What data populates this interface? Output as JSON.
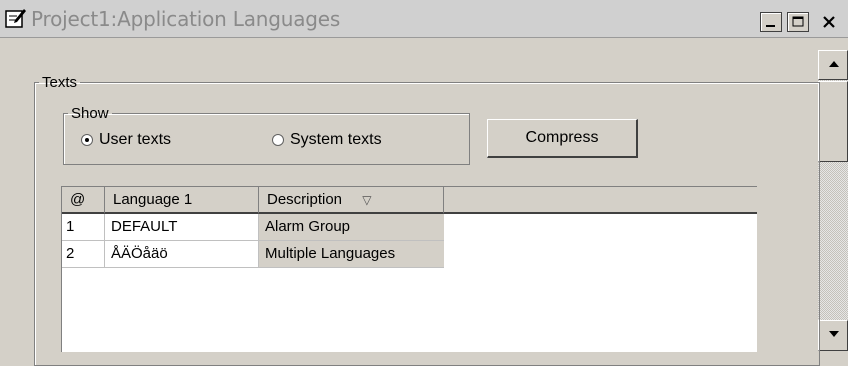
{
  "window": {
    "title": "Project1:Application Languages",
    "icon": "edit-document-icon",
    "controls": [
      "minimize-icon",
      "maximize-icon",
      "close-icon"
    ]
  },
  "texts_group": {
    "legend": "Texts",
    "show_group": {
      "legend": "Show",
      "options": [
        {
          "label": "User texts",
          "selected": true
        },
        {
          "label": "System texts",
          "selected": false
        }
      ]
    },
    "compress_label": "Compress"
  },
  "grid": {
    "columns": [
      "@",
      "Language 1",
      "Description"
    ],
    "sort_indicator": "▽",
    "rows": [
      {
        "num": "1",
        "lang": "DEFAULT",
        "desc": "Alarm Group"
      },
      {
        "num": "2",
        "lang": "ÅÄÖåäö",
        "desc": "Multiple Languages"
      }
    ]
  },
  "scrollbar": {
    "up_icon": "arrow-up-icon",
    "down_icon": "arrow-down-icon"
  }
}
